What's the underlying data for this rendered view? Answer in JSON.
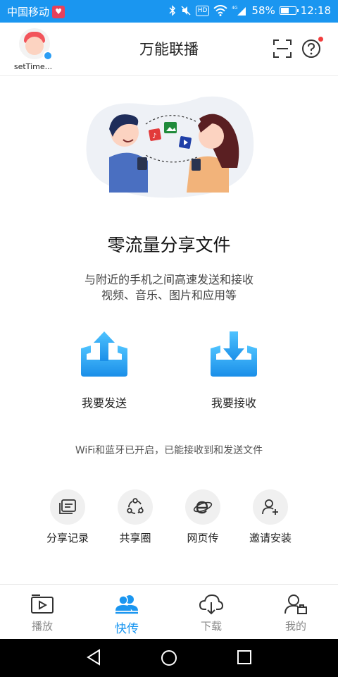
{
  "status_bar": {
    "carrier": "中国移动",
    "network": "4G",
    "battery": "58%",
    "battery_level": 0.58,
    "time": "12:18",
    "hd_label": "HD"
  },
  "header": {
    "user_name": "setTime...",
    "title": "万能联播"
  },
  "main": {
    "headline": "零流量分享文件",
    "description_line1": "与附近的手机之间高速发送和接收",
    "description_line2": "视频、音乐、图片和应用等",
    "send_label": "我要发送",
    "receive_label": "我要接收",
    "status_text": "WiFi和蓝牙已开启，已能接收到和发送文件"
  },
  "tools": [
    {
      "label": "分享记录",
      "icon": "history-icon"
    },
    {
      "label": "共享圈",
      "icon": "share-circle-icon"
    },
    {
      "label": "网页传",
      "icon": "web-transfer-icon"
    },
    {
      "label": "邀请安装",
      "icon": "invite-user-icon"
    }
  ],
  "tabs": [
    {
      "label": "播放",
      "icon": "play-icon",
      "active": false
    },
    {
      "label": "快传",
      "icon": "users-icon",
      "active": true
    },
    {
      "label": "下载",
      "icon": "cloud-download-icon",
      "active": false
    },
    {
      "label": "我的",
      "icon": "profile-icon",
      "active": false
    }
  ],
  "colors": {
    "accent": "#1a96f0",
    "status_bar": "#1a96f0",
    "notification_dot": "#f23c3c"
  }
}
